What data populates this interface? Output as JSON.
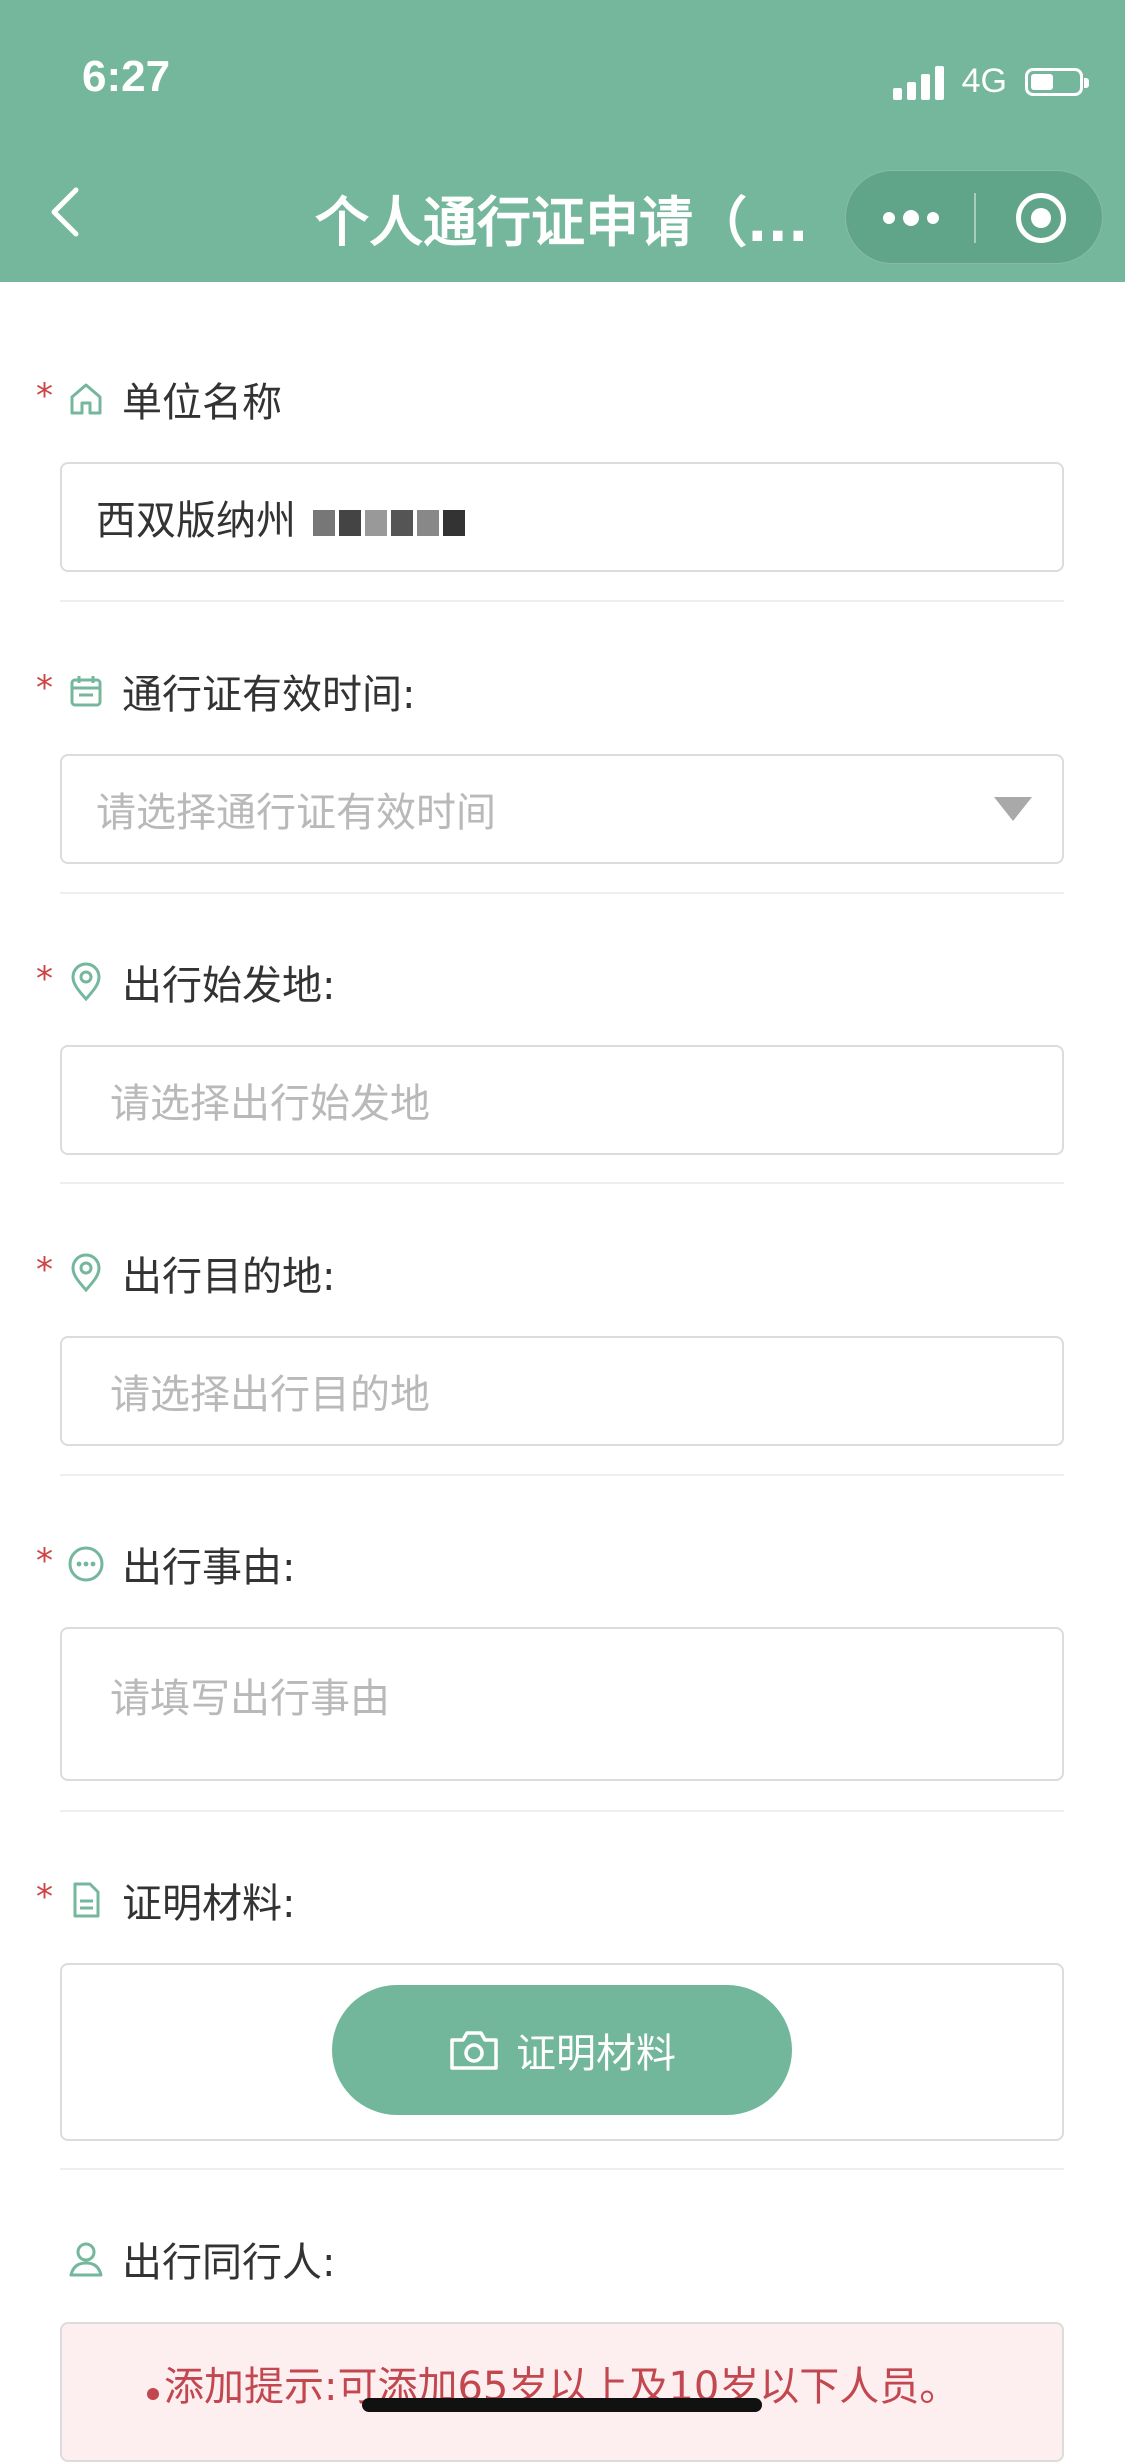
{
  "status_bar": {
    "time": "6:27",
    "network": "4G"
  },
  "nav": {
    "title": "个人通行证申请（..."
  },
  "form": {
    "unit_name": {
      "label": "单位名称",
      "value": "西双版纳州"
    },
    "valid_time": {
      "label": "通行证有效时间:",
      "placeholder": "请选择通行证有效时间"
    },
    "origin": {
      "label": "出行始发地:",
      "placeholder": "请选择出行始发地"
    },
    "destination": {
      "label": "出行目的地:",
      "placeholder": "请选择出行目的地"
    },
    "reason": {
      "label": "出行事由:",
      "placeholder": "请填写出行事由"
    },
    "proof": {
      "label": "证明材料:",
      "button": "证明材料"
    },
    "companions": {
      "label": "出行同行人:",
      "notice": "添加提示:可添加65岁以上及10岁以下人员。"
    }
  },
  "colors": {
    "brand": "#74b79d",
    "required": "#cc4444",
    "notice_text": "#c2474f"
  },
  "icons": [
    "home-icon",
    "calendar-icon",
    "location-pin-icon",
    "more-circle-icon",
    "document-icon",
    "person-icon",
    "camera-icon",
    "back-icon"
  ]
}
